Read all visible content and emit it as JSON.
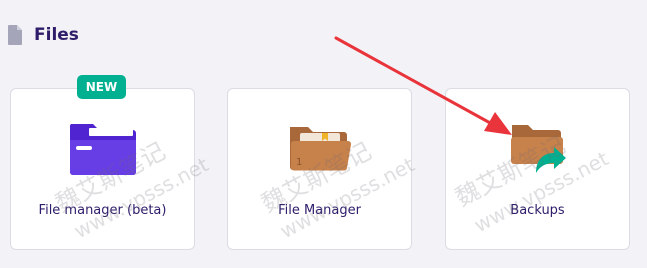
{
  "section": {
    "title": "Files",
    "icon": "document-icon"
  },
  "cards": [
    {
      "label": "File manager (beta)",
      "icon": "purple-folder-icon",
      "badge": "NEW"
    },
    {
      "label": "File Manager",
      "icon": "brown-folder-icon"
    },
    {
      "label": "Backups",
      "icon": "backup-folder-icon"
    }
  ],
  "watermark": {
    "text_cn": "魏艾斯笔记",
    "text_url": "www.vpsss.net"
  },
  "colors": {
    "background": "#f3f3f7",
    "card": "#ffffff",
    "title": "#2f1c6a",
    "badge": "#00b090",
    "purple_folder": "#673de6",
    "brown_folder": "#c7814b",
    "backup_arrow": "#00b090",
    "annotation_arrow": "#e8343a"
  }
}
